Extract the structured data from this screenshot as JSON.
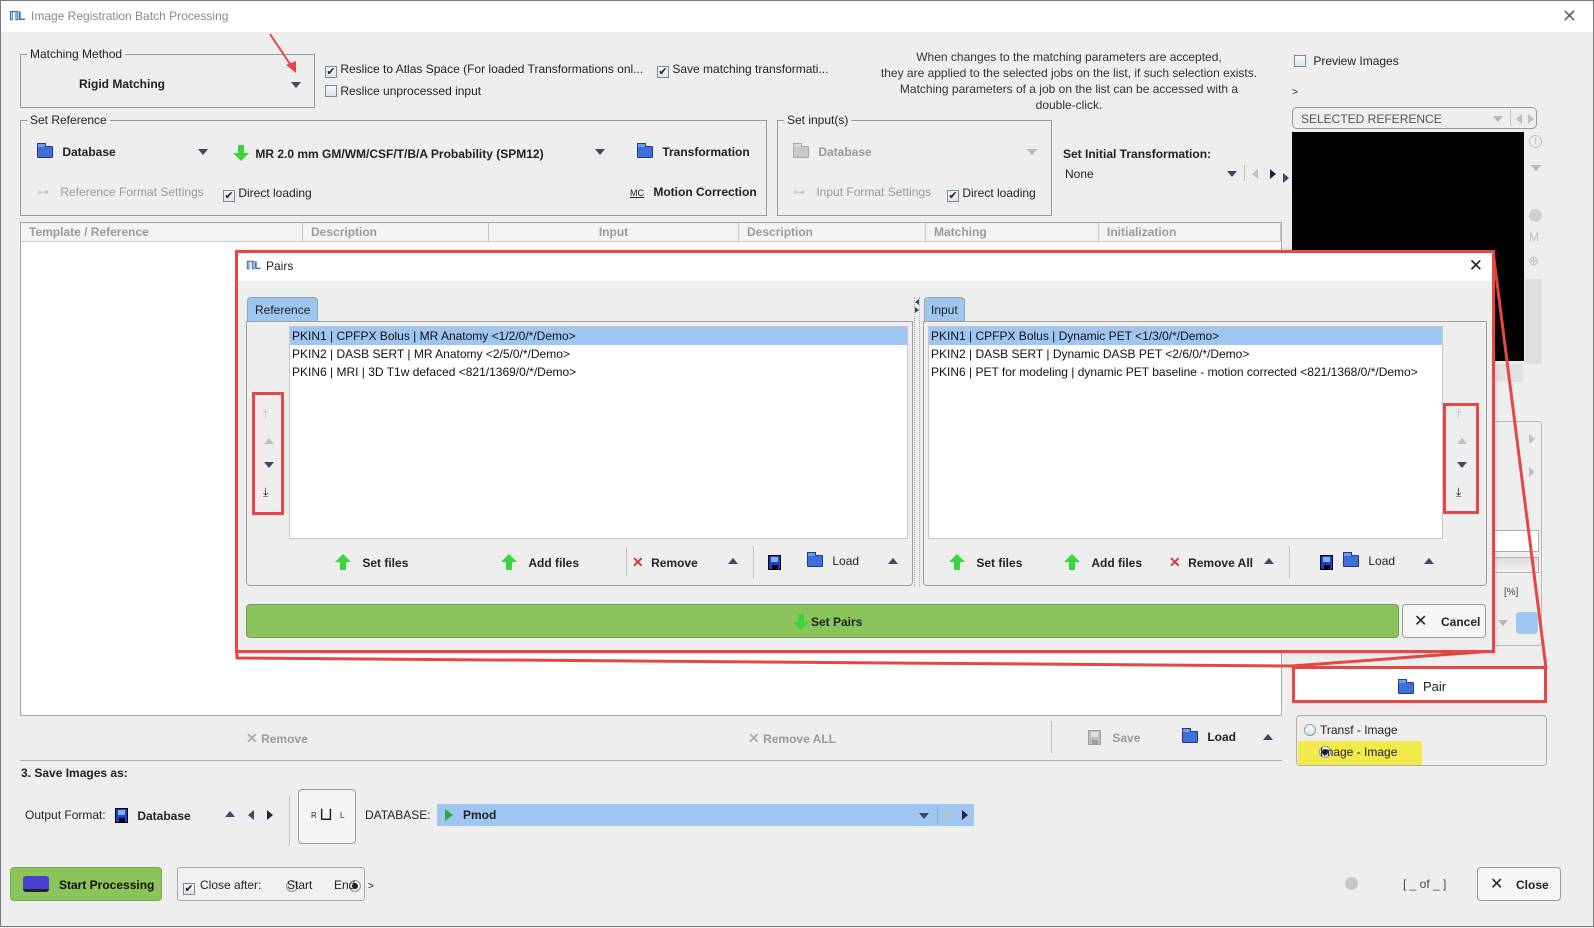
{
  "window": {
    "title": "Image Registration Batch Processing",
    "logo": "PMOD-logo"
  },
  "matching": {
    "legend": "Matching Method",
    "value": "Rigid Matching",
    "reslice_atlas_label": "Reslice to Atlas Space (For loaded Transformations onl...",
    "reslice_atlas_checked": true,
    "save_transform_label": "Save matching transformati...",
    "save_transform_checked": true,
    "reslice_unprocessed_label": "Reslice unprocessed input",
    "reslice_unprocessed_checked": false,
    "info_lines": [
      "When changes to the matching parameters are accepted,",
      "they are applied to the selected jobs on the list, if such selection exists.",
      "Matching parameters of a job on the list can be accessed with a",
      "double-click."
    ]
  },
  "reference": {
    "legend": "Set Reference",
    "source": "Database",
    "template": "MR 2.0 mm GM/WM/CSF/T/B/A Probability (SPM12)",
    "transformation_label": "Transformation",
    "format_settings_label": "Reference Format Settings",
    "direct_loading_label": "Direct loading",
    "direct_loading_checked": true,
    "motion_correction_label": "Motion Correction"
  },
  "inputs": {
    "legend": "Set input(s)",
    "source": "Database",
    "format_settings_label": "Input Format Settings",
    "direct_loading_label": "Direct loading",
    "direct_loading_checked": true
  },
  "initial_transform": {
    "label": "Set Initial Transformation:",
    "value": "None"
  },
  "job_table": {
    "columns": [
      "Template / Reference",
      "Description",
      "Input",
      "Description",
      "Matching",
      "Initialization"
    ]
  },
  "job_actions": {
    "remove": "Remove",
    "remove_all": "Remove ALL",
    "save": "Save",
    "load": "Load"
  },
  "preview": {
    "preview_images_label": "Preview Images",
    "preview_checked": false,
    "expand": ">",
    "selector": "SELECTED REFERENCE",
    "percent_label": "[%]"
  },
  "pair_button": {
    "label": "Pair",
    "options": [
      {
        "label": "Transf - Image",
        "selected": false
      },
      {
        "label": "Image - Image",
        "selected": true
      }
    ],
    "highlight_color": "#f2ea4a"
  },
  "save_images": {
    "heading": "3. Save Images as:",
    "output_format_label": "Output Format:",
    "output_format_value": "Database",
    "database_label": "DATABASE:",
    "database_value": "Pmod",
    "orientation_left": "R",
    "orientation_right": "L"
  },
  "footer": {
    "start_label": "Start Processing",
    "close_after_label": "Close after:",
    "close_after_checked": true,
    "close_after_options": [
      {
        "label": "Start",
        "selected": false
      },
      {
        "label": "End",
        "selected": true
      }
    ],
    "expand": ">",
    "counter": "[ _ of _ ]",
    "close_label": "Close"
  },
  "pairs_dialog": {
    "title": "Pairs",
    "reference_tab": "Reference",
    "input_tab": "Input",
    "reference_items": [
      {
        "label": "PKIN1 | CPFPX Bolus | MR Anatomy <1/2/0/*/Demo>",
        "selected": true
      },
      {
        "label": "PKIN2 | DASB SERT | MR Anatomy <2/5/0/*/Demo>",
        "selected": false
      },
      {
        "label": "PKIN6 | MRI | 3D T1w defaced <821/1369/0/*/Demo>",
        "selected": false
      }
    ],
    "input_items": [
      {
        "label": "PKIN1 | CPFPX Bolus | Dynamic PET <1/3/0/*/Demo>",
        "selected": true
      },
      {
        "label": "PKIN2 | DASB SERT | Dynamic DASB PET <2/6/0/*/Demo>",
        "selected": false
      },
      {
        "label": "PKIN6 | PET for modeling | dynamic PET baseline - motion corrected <821/1368/0/*/Demo>",
        "selected": false
      }
    ],
    "ref_toolbar": {
      "set_files": "Set files",
      "add_files": "Add files",
      "remove": "Remove",
      "load": "Load"
    },
    "input_toolbar": {
      "set_files": "Set files",
      "add_files": "Add files",
      "remove_all": "Remove All",
      "load": "Load"
    },
    "set_pairs_label": "Set Pairs",
    "cancel_label": "Cancel"
  },
  "colors": {
    "accent_green": "#8bc45a",
    "selection_blue": "#9ec6f0",
    "annotation_red": "#e84545"
  }
}
